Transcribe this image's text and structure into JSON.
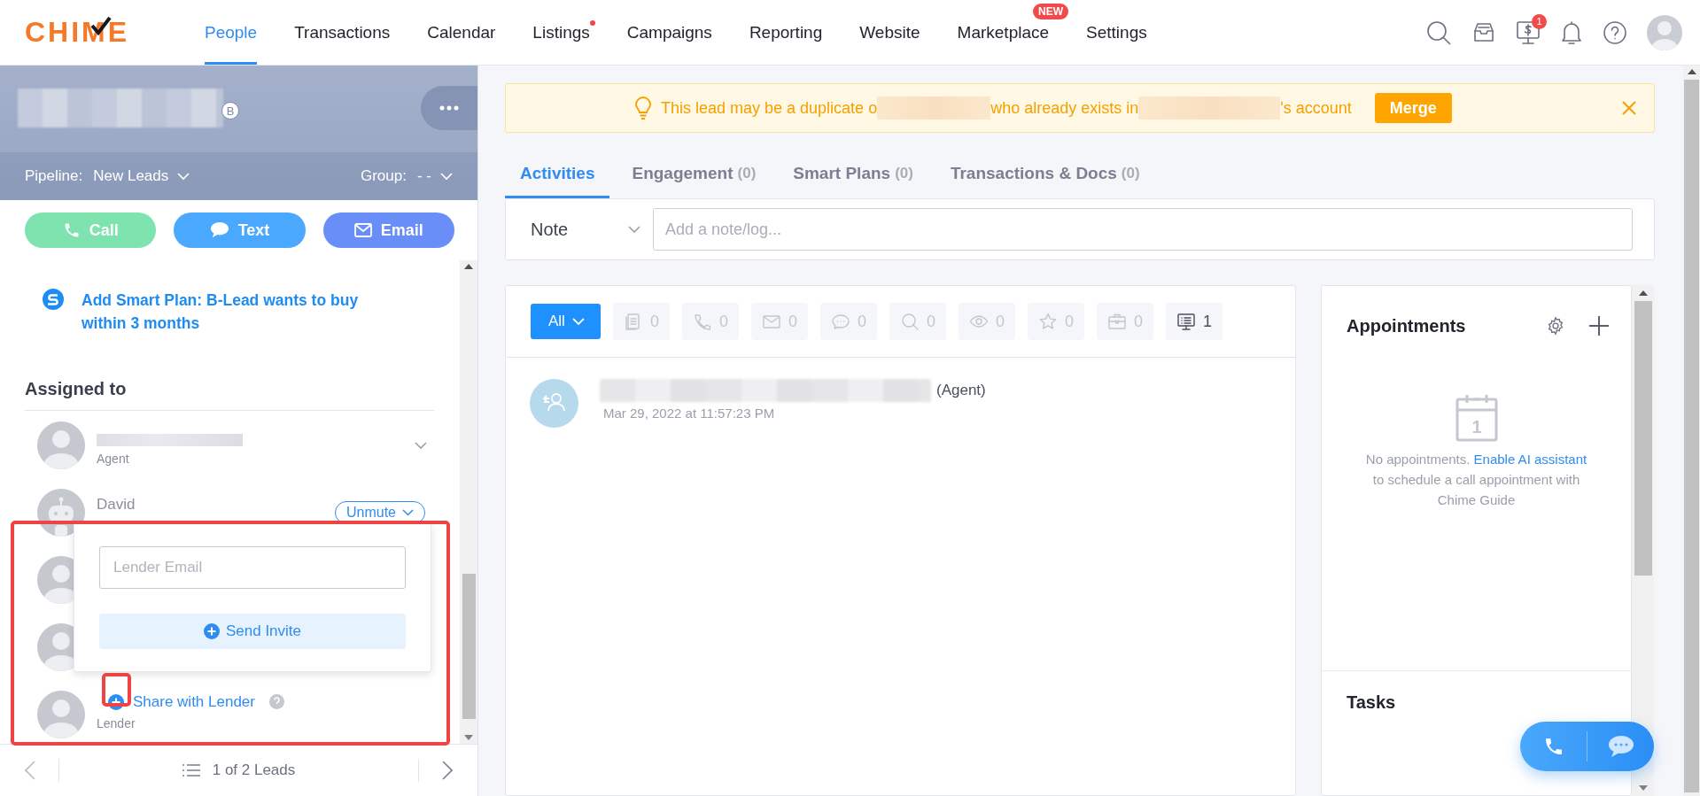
{
  "nav": {
    "logo": "CHIME",
    "items": [
      {
        "label": "People",
        "selected": true
      },
      {
        "label": "Transactions",
        "selected": false
      },
      {
        "label": "Calendar",
        "selected": false
      },
      {
        "label": "Listings",
        "selected": false,
        "dot": true
      },
      {
        "label": "Campaigns",
        "selected": false
      },
      {
        "label": "Reporting",
        "selected": false
      },
      {
        "label": "Website",
        "selected": false
      },
      {
        "label": "Marketplace",
        "selected": false,
        "badge": "NEW"
      },
      {
        "label": "Settings",
        "selected": false
      }
    ],
    "monitor_badge": "1"
  },
  "lead": {
    "tag": "B",
    "pipeline_label": "Pipeline:",
    "pipeline": "New Leads",
    "group_label": "Group:",
    "group": "- -",
    "actions": [
      {
        "kind": "call",
        "label": "Call"
      },
      {
        "kind": "text",
        "label": "Text"
      },
      {
        "kind": "email",
        "label": "Email"
      }
    ],
    "smart_plan": "Add Smart Plan: B-Lead wants to buy within 3 months",
    "assigned_title": "Assigned to",
    "assignees": [
      {
        "kind": "agent",
        "role": "Agent"
      },
      {
        "kind": "bot",
        "name": "David",
        "action": "Unmute"
      },
      {
        "kind": "hidden"
      },
      {
        "kind": "hidden"
      },
      {
        "kind": "lender",
        "action": "Share with Lender",
        "role": "Lender"
      }
    ],
    "popover": {
      "placeholder": "Lender Email",
      "button": "Send Invite"
    },
    "pager": "1 of 2 Leads"
  },
  "banner": {
    "before": "This lead may be a duplicate o",
    "middle": "who already exists in",
    "after": "'s account",
    "button": "Merge"
  },
  "tabs": [
    {
      "label": "Activities",
      "selected": true
    },
    {
      "label": "Engagement",
      "count": "(0)",
      "selected": false
    },
    {
      "label": "Smart Plans",
      "count": "(0)",
      "selected": false
    },
    {
      "label": "Transactions & Docs",
      "count": "(0)",
      "selected": false
    }
  ],
  "note": {
    "type": "Note",
    "placeholder": "Add a note/log..."
  },
  "filters": [
    {
      "kind": "all",
      "label": "All",
      "selected": true
    },
    {
      "kind": "notes",
      "count": "0",
      "selected": false,
      "empty": true
    },
    {
      "kind": "calls",
      "count": "0",
      "selected": false,
      "empty": true
    },
    {
      "kind": "emails",
      "count": "0",
      "selected": false,
      "empty": true
    },
    {
      "kind": "texts",
      "count": "0",
      "selected": false,
      "empty": true
    },
    {
      "kind": "searches",
      "count": "0",
      "selected": false,
      "empty": true
    },
    {
      "kind": "views",
      "count": "0",
      "selected": false,
      "empty": true
    },
    {
      "kind": "favorites",
      "count": "0",
      "selected": false,
      "empty": true
    },
    {
      "kind": "transactions",
      "count": "0",
      "selected": false,
      "empty": true
    },
    {
      "kind": "system",
      "count": "1",
      "selected": false,
      "empty": false
    }
  ],
  "activity": [
    {
      "suffix": "(Agent)",
      "time": "Mar 29, 2022 at 11:57:23 PM"
    }
  ],
  "appointments": {
    "title": "Appointments",
    "calendar_day": "1",
    "empty_text": "No appointments. ",
    "link": "Enable AI assistant",
    "after": " to schedule a call appointment with Chime Guide"
  },
  "tasks": {
    "title": "Tasks"
  }
}
